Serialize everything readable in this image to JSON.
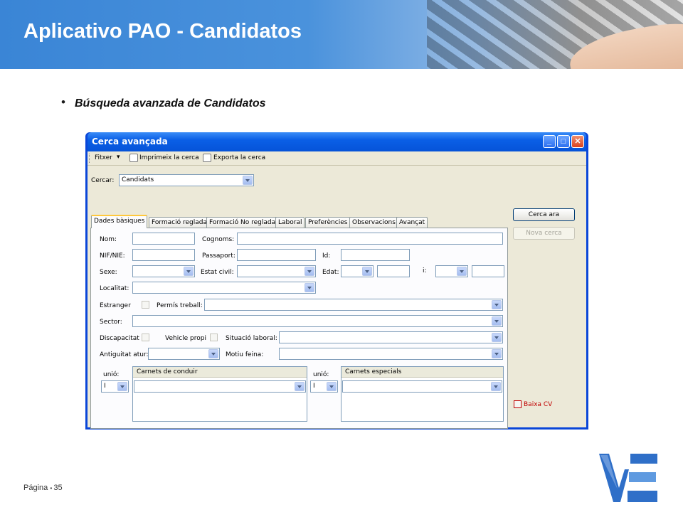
{
  "slide": {
    "title": "Aplicativo PAO - Candidatos",
    "bullet": "Búsqueda avanzada de Candidatos",
    "footer_label": "Página",
    "page_number": "35"
  },
  "window": {
    "title": "Cerca avançada",
    "toolbar": {
      "file_menu": "Fitxer",
      "print": "Imprimeix la cerca",
      "export": "Exporta la cerca"
    },
    "search_label": "Cercar:",
    "search_value": "Candidats",
    "tabs": [
      "Dades bàsiques",
      "Formació reglada",
      "Formació No reglada",
      "Laboral",
      "Preferències",
      "Observacions",
      "Avançat"
    ],
    "fields": {
      "nom": "Nom:",
      "cognoms": "Cognoms:",
      "nif": "NIF/NIE:",
      "passaport": "Passaport:",
      "id": "Id:",
      "sexe": "Sexe:",
      "estat_civil": "Estat civil:",
      "edat": "Edat:",
      "i": "i:",
      "localitat": "Localitat:",
      "estranger": "Estranger",
      "permis": "Permís treball:",
      "sector": "Sector:",
      "discapacitat": "Discapacitat",
      "vehicle": "Vehicle propi",
      "situacio": "Situació laboral:",
      "antiguitat": "Antiguitat atur:",
      "motiu": "Motiu feina:",
      "unio": "unió:",
      "unio_value": "I",
      "carnets_conduir": "Carnets de conduir",
      "carnets_especials": "Carnets especials"
    },
    "buttons": {
      "search": "Cerca ara",
      "new_search": "Nova cerca"
    },
    "baixa_cv": "Baixa CV"
  },
  "colors": {
    "header_blue": "#3a85d6",
    "xp_title": "#0a5fe6",
    "baixa_red": "#c00000"
  }
}
